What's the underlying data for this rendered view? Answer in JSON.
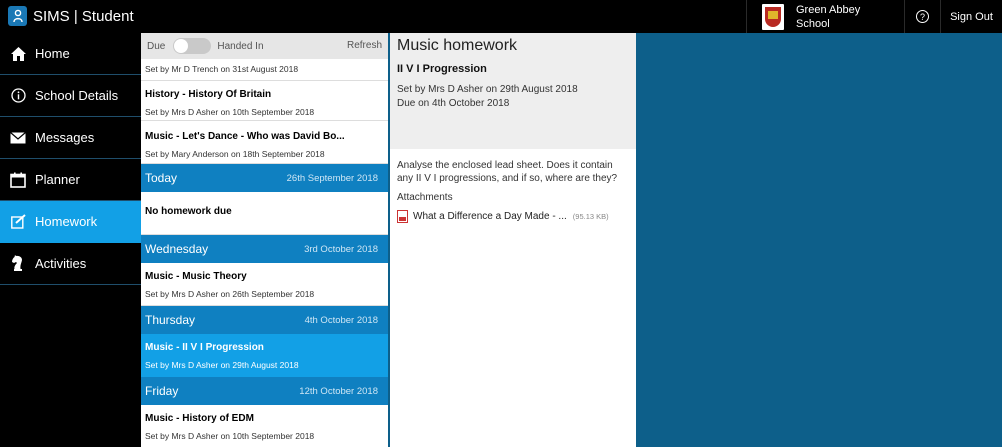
{
  "app": {
    "title": "SIMS | Student"
  },
  "header": {
    "school_name": "Green Abbey School",
    "help_label": "?",
    "sign_out": "Sign Out"
  },
  "sidebar": {
    "items": [
      {
        "label": "Home",
        "icon": "home-icon"
      },
      {
        "label": "School Details",
        "icon": "info-icon"
      },
      {
        "label": "Messages",
        "icon": "envelope-icon"
      },
      {
        "label": "Planner",
        "icon": "calendar-icon"
      },
      {
        "label": "Homework",
        "icon": "homework-icon",
        "active": true
      },
      {
        "label": "Activities",
        "icon": "chess-knight-icon"
      }
    ]
  },
  "list": {
    "toggle_left": "Due",
    "toggle_right": "Handed In",
    "refresh": "Refresh",
    "top_items": [
      {
        "title": "",
        "sub": "Set by Mr D Trench on 31st August 2018"
      },
      {
        "title": "History - History Of Britain",
        "sub": "Set by Mrs D Asher on 10th September 2018"
      },
      {
        "title": "Music - Let's Dance - Who was David Bo...",
        "sub": "Set by Mary Anderson on 18th September 2018"
      }
    ],
    "groups": [
      {
        "day": "Today",
        "date": "26th September 2018",
        "items": [
          {
            "title": "No homework due",
            "sub": ""
          }
        ]
      },
      {
        "day": "Wednesday",
        "date": "3rd October 2018",
        "items": [
          {
            "title": "Music - Music Theory",
            "sub": "Set by Mrs D Asher on 26th September 2018"
          }
        ]
      },
      {
        "day": "Thursday",
        "date": "4th October 2018",
        "items": [
          {
            "title": "Music - II V I Progression",
            "sub": "Set by Mrs D Asher on 29th August 2018",
            "selected": true
          }
        ]
      },
      {
        "day": "Friday",
        "date": "12th October 2018",
        "items": [
          {
            "title": "Music - History of EDM",
            "sub": "Set by Mrs D Asher on 10th September 2018"
          }
        ]
      }
    ]
  },
  "detail": {
    "heading": "Music homework",
    "title": "II V I Progression",
    "set_by": "Set by Mrs D Asher on 29th August 2018",
    "due": "Due on 4th October 2018",
    "description": "Analyse the enclosed lead sheet. Does it contain any II V I progressions, and if so, where are they?",
    "attachments_label": "Attachments",
    "attachment_name": "What a Difference a Day Made - ...",
    "attachment_size": "(95.13 KB)"
  },
  "colors": {
    "accent": "#12a0e6",
    "group_header": "#0f80c1",
    "background": "#0d5f8a"
  }
}
